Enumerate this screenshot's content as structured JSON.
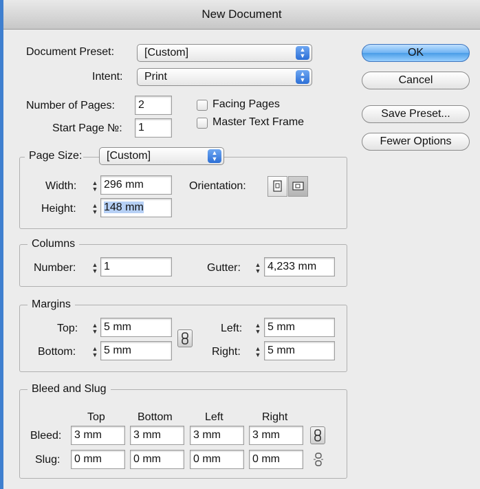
{
  "window": {
    "title": "New Document"
  },
  "document": {
    "preset_label": "Document Preset:",
    "preset_value": "[Custom]",
    "intent_label": "Intent:",
    "intent_value": "Print",
    "pages_label": "Number of Pages:",
    "pages_value": "2",
    "start_label": "Start Page №:",
    "start_value": "1",
    "facing_pages_label": "Facing Pages",
    "master_text_label": "Master Text Frame"
  },
  "buttons": {
    "ok": "OK",
    "cancel": "Cancel",
    "save_preset": "Save Preset...",
    "fewer_options": "Fewer Options"
  },
  "page_size": {
    "label": "Page Size:",
    "value": "[Custom]",
    "width_label": "Width:",
    "width_value": "296 mm",
    "height_label": "Height:",
    "height_value": "148 mm",
    "orientation_label": "Orientation:"
  },
  "columns": {
    "title": "Columns",
    "number_label": "Number:",
    "number_value": "1",
    "gutter_label": "Gutter:",
    "gutter_value": "4,233 mm"
  },
  "margins": {
    "title": "Margins",
    "top_label": "Top:",
    "top_value": "5 mm",
    "bottom_label": "Bottom:",
    "bottom_value": "5 mm",
    "left_label": "Left:",
    "left_value": "5 mm",
    "right_label": "Right:",
    "right_value": "5 mm"
  },
  "bleed_slug": {
    "title": "Bleed and Slug",
    "col_top": "Top",
    "col_bottom": "Bottom",
    "col_left": "Left",
    "col_right": "Right",
    "bleed_label": "Bleed:",
    "bleed_top": "3 mm",
    "bleed_bottom": "3 mm",
    "bleed_left": "3 mm",
    "bleed_right": "3 mm",
    "slug_label": "Slug:",
    "slug_top": "0 mm",
    "slug_bottom": "0 mm",
    "slug_left": "0 mm",
    "slug_right": "0 mm"
  }
}
